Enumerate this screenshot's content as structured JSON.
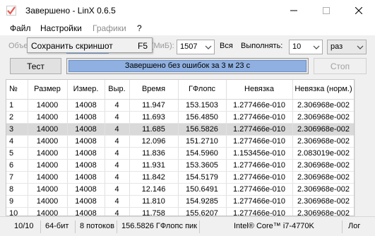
{
  "window": {
    "title": "Завершено - LinX 0.6.5"
  },
  "menu": {
    "file": "Файл",
    "settings": "Настройки",
    "graphs": "Графики",
    "help": "?"
  },
  "tooltip": {
    "label": "Сохранить скриншот",
    "key": "F5"
  },
  "controls": {
    "tasks_label_partial": "Объем",
    "memory_label_partial": "Памяти (МиБ):",
    "memory_value": "1507",
    "all_label": "Вся",
    "run_label": "Выполнять:",
    "run_value": "10",
    "unit_value": "раз",
    "test_button": "Тест",
    "stop_button": "Стоп",
    "progress_text": "Завершено без ошибок за 3 м 23 с",
    "progress_fraction": 1.0
  },
  "table": {
    "columns": [
      "№",
      "Размер",
      "Измер.",
      "Выр.",
      "Время",
      "ГФлопс",
      "Невязка",
      "Невязка (норм.)"
    ],
    "rows": [
      [
        "1",
        "14000",
        "14008",
        "4",
        "11.947",
        "153.1503",
        "1.277466e-010",
        "2.306968e-002"
      ],
      [
        "2",
        "14000",
        "14008",
        "4",
        "11.693",
        "156.4850",
        "1.277466e-010",
        "2.306968e-002"
      ],
      [
        "3",
        "14000",
        "14008",
        "4",
        "11.685",
        "156.5826",
        "1.277466e-010",
        "2.306968e-002"
      ],
      [
        "4",
        "14000",
        "14008",
        "4",
        "12.096",
        "151.2710",
        "1.277466e-010",
        "2.306968e-002"
      ],
      [
        "5",
        "14000",
        "14008",
        "4",
        "11.836",
        "154.5960",
        "1.153456e-010",
        "2.083019e-002"
      ],
      [
        "6",
        "14000",
        "14008",
        "4",
        "11.931",
        "153.3605",
        "1.277466e-010",
        "2.306968e-002"
      ],
      [
        "7",
        "14000",
        "14008",
        "4",
        "11.842",
        "154.5179",
        "1.277466e-010",
        "2.306968e-002"
      ],
      [
        "8",
        "14000",
        "14008",
        "4",
        "12.146",
        "150.6491",
        "1.277466e-010",
        "2.306968e-002"
      ],
      [
        "9",
        "14000",
        "14008",
        "4",
        "11.810",
        "154.9285",
        "1.277466e-010",
        "2.306968e-002"
      ],
      [
        "10",
        "14000",
        "14008",
        "4",
        "11.758",
        "155.6207",
        "1.277466e-010",
        "2.306968e-002"
      ]
    ],
    "selected_row": 2
  },
  "status": {
    "count": "10/10",
    "bits": "64-бит",
    "threads": "8 потоков",
    "peak": "156.5826 ГФлопс пик",
    "cpu": "Intel® Core™ i7-4770K",
    "log": "Лог"
  },
  "icons": {
    "app": "checkmark-icon",
    "minimize": "minimize-icon",
    "maximize": "maximize-icon",
    "close": "close-icon",
    "dropdown": "chevron-down-icon"
  },
  "colors": {
    "progress_fill": "#8fb0e0",
    "selected_row": "#d9d9d9",
    "app_icon": "#e85a4f"
  }
}
